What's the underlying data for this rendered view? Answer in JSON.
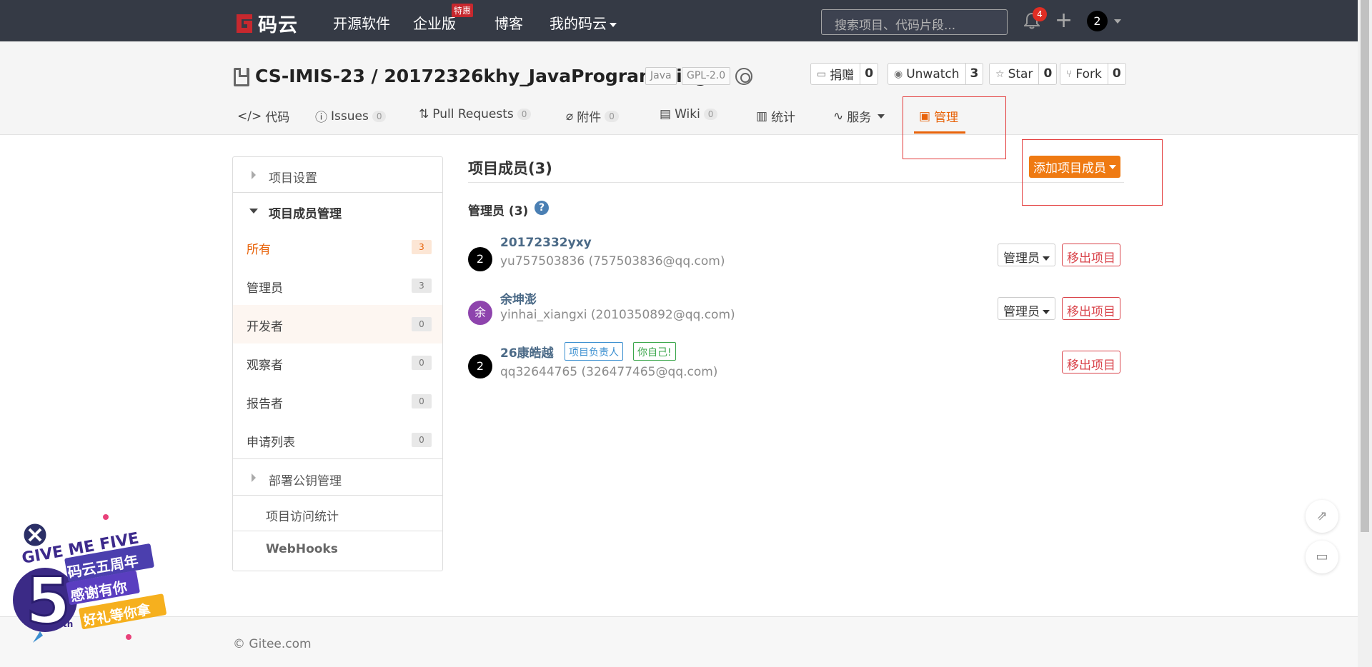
{
  "topnav": {
    "logo_text": "码云",
    "links": [
      "开源软件",
      "企业版",
      "博客",
      "我的码云"
    ],
    "hot_badge": "特惠",
    "search_placeholder": "搜索项目、代码片段...",
    "notifications_count": "4",
    "user_avatar": "2"
  },
  "repo": {
    "title": "CS-IMIS-23 / 20172326khy_JavaProgramming",
    "tags": [
      "Java",
      "GPL-2.0"
    ],
    "actions": [
      {
        "label": "捐赠",
        "count": "0",
        "icon": "donate-icon"
      },
      {
        "label": "Unwatch",
        "count": "3",
        "icon": "eye-icon"
      },
      {
        "label": "Star",
        "count": "0",
        "icon": "star-icon"
      },
      {
        "label": "Fork",
        "count": "0",
        "icon": "fork-icon"
      }
    ]
  },
  "tabs": [
    {
      "label": "代码",
      "icon": "code-icon"
    },
    {
      "label": "Issues",
      "count": "0",
      "icon": "issue-icon"
    },
    {
      "label": "Pull Requests",
      "count": "0",
      "icon": "pull-request-icon"
    },
    {
      "label": "附件",
      "count": "0",
      "icon": "attachment-icon"
    },
    {
      "label": "Wiki",
      "count": "0",
      "icon": "wiki-icon"
    },
    {
      "label": "统计",
      "icon": "stats-icon"
    },
    {
      "label": "服务",
      "icon": "pulse-icon"
    },
    {
      "label": "管理",
      "icon": "manage-icon",
      "active": true
    }
  ],
  "sidebar": {
    "section_settings": "项目设置",
    "section_members": "项目成员管理",
    "items": [
      {
        "label": "所有",
        "count": "3"
      },
      {
        "label": "管理员",
        "count": "3"
      },
      {
        "label": "开发者",
        "count": "0"
      },
      {
        "label": "观察者",
        "count": "0"
      },
      {
        "label": "报告者",
        "count": "0"
      },
      {
        "label": "申请列表",
        "count": "0"
      }
    ],
    "section_deploy_keys": "部署公钥管理",
    "section_access_stats": "项目访问统计",
    "section_webhooks": "WebHooks"
  },
  "main": {
    "title": "项目成员(3)",
    "add_button": "添加项目成员",
    "subtitle": "管理员 (3)",
    "help": "?",
    "members": [
      {
        "avatar": "2",
        "avatar_color": "#000000",
        "name": "20172332yxy",
        "sub": "yu757503836 (757503836@qq.com)",
        "role": "管理员",
        "remove": "移出项目"
      },
      {
        "avatar": "余",
        "avatar_color": "#8e44ad",
        "name": "余坤澎",
        "sub": "yinhai_xiangxi (2010350892@qq.com)",
        "role": "管理员",
        "remove": "移出项目"
      },
      {
        "avatar": "2",
        "avatar_color": "#000000",
        "name": "26康皓越",
        "sub": "qq32644765 (326477465@qq.com)",
        "tag_owner": "项目负责人",
        "tag_self": "你自己!",
        "remove": "移出项目"
      }
    ]
  },
  "footer": {
    "copyright": "© Gitee.com"
  },
  "promo": {
    "line1": "GIVE ME FIVE",
    "line2": "码云五周年",
    "line3": "感谢有你",
    "line4": "好礼等你拿",
    "number": "5",
    "suffix": "th"
  },
  "colors": {
    "accent": "#e8630a",
    "nav_bg": "#353a45",
    "danger": "#d9434a",
    "link": "#4b6a87"
  }
}
